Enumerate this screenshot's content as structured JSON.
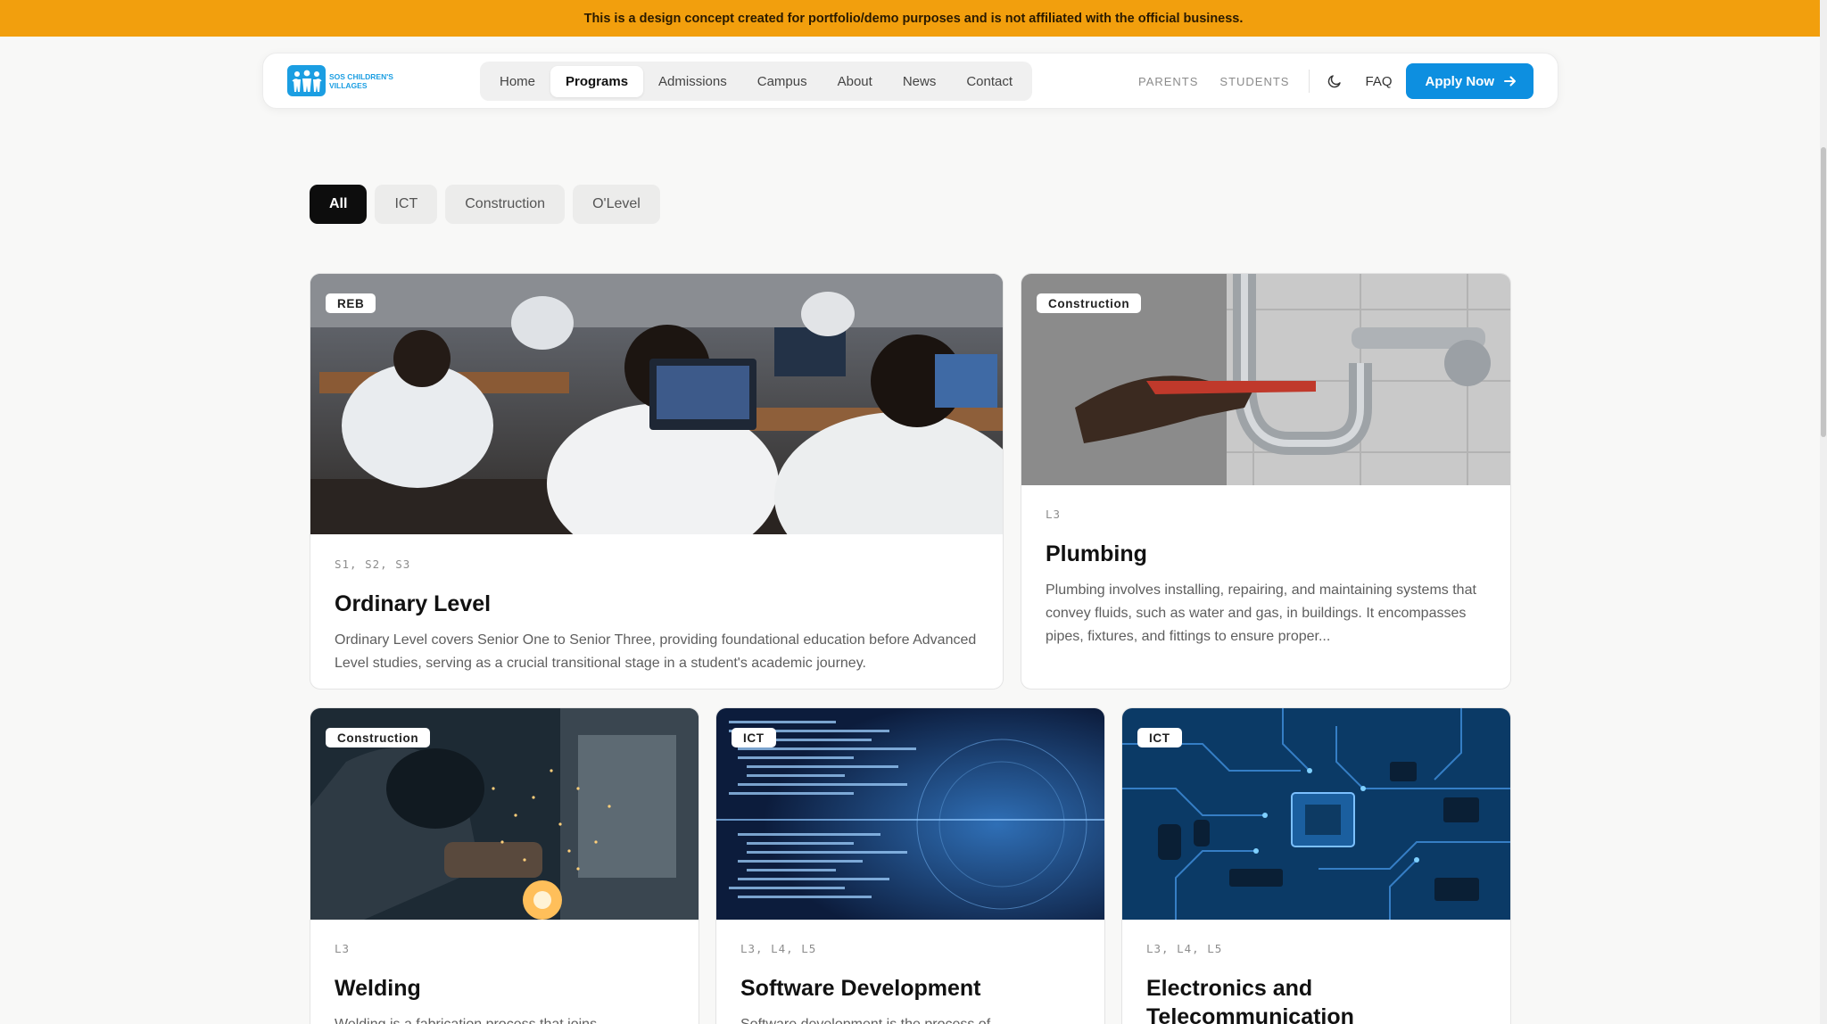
{
  "banner": {
    "text": "This is a design concept created for portfolio/demo purposes and is not affiliated with the official business."
  },
  "brand": {
    "name": "SOS CHILDREN'S VILLAGES",
    "accent": "#1b9ee2"
  },
  "nav": {
    "items": [
      {
        "label": "Home",
        "active": false
      },
      {
        "label": "Programs",
        "active": true
      },
      {
        "label": "Admissions",
        "active": false
      },
      {
        "label": "Campus",
        "active": false
      },
      {
        "label": "About",
        "active": false
      },
      {
        "label": "News",
        "active": false
      },
      {
        "label": "Contact",
        "active": false
      }
    ],
    "parents": "PARENTS",
    "students": "STUDENTS",
    "theme_icon": "moon-icon",
    "faq": "FAQ",
    "apply": "Apply Now",
    "apply_icon": "arrow-right-icon",
    "apply_color": "#0d8fe0"
  },
  "filters": [
    {
      "label": "All",
      "active": true
    },
    {
      "label": "ICT",
      "active": false
    },
    {
      "label": "Construction",
      "active": false
    },
    {
      "label": "O'Level",
      "active": false
    }
  ],
  "programs": [
    {
      "badge": "REB",
      "levels": "S1, S2, S3",
      "title": "Ordinary Level",
      "description": "Ordinary Level covers Senior One to Senior Three, providing foundational education before Advanced Level studies, serving as a crucial transitional stage in a student's academic journey."
    },
    {
      "badge": "Construction",
      "levels": "L3",
      "title": "Plumbing",
      "description": "Plumbing involves installing, repairing, and maintaining systems that convey fluids, such as water and gas, in buildings. It encompasses pipes, fixtures, and fittings to ensure proper..."
    },
    {
      "badge": "Construction",
      "levels": "L3",
      "title": "Welding",
      "description": "Welding is a fabrication process that joins"
    },
    {
      "badge": "ICT",
      "levels": "L3, L4, L5",
      "title": "Software Development",
      "description": "Software development is the process of"
    },
    {
      "badge": "ICT",
      "levels": "L3, L4, L5",
      "title": "Electronics and Telecommunication",
      "description": ""
    }
  ]
}
